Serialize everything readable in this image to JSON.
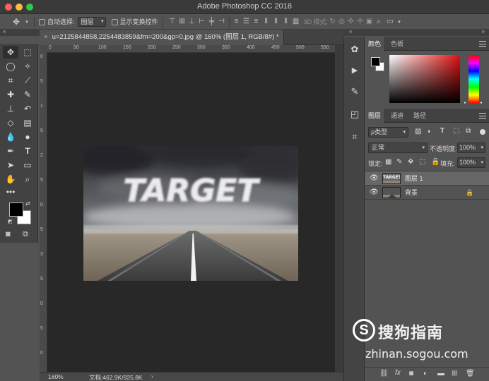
{
  "window": {
    "title": "Adobe Photoshop CC 2018"
  },
  "options_bar": {
    "auto_select_label": "自动选择:",
    "auto_select_value": "图层",
    "show_transform_label": "显示变换控件",
    "mode_3d_label": "3D 模式:"
  },
  "document": {
    "tab_title": "u=2125844858,2254483859&fm=200&gp=0.jpg @ 160% (图层 1, RGB/8#) *",
    "ruler_top_ticks": [
      "0",
      "50",
      "100",
      "150",
      "200",
      "250",
      "300",
      "350",
      "400",
      "450",
      "500",
      "550"
    ],
    "ruler_left_ticks": [
      "0",
      "5",
      "1",
      "5",
      "2",
      "5",
      "0",
      "5",
      "3",
      "5",
      "0",
      "5",
      "0"
    ],
    "artwork_text": "TARGET",
    "status": {
      "zoom": "160%",
      "doc_size": "文档:462.9K/925.8K"
    }
  },
  "colors": {
    "foreground": "#000000",
    "background": "#ffffff",
    "picker_hue": "#e01010"
  },
  "panels": {
    "color_tabs": [
      "颜色",
      "色板"
    ],
    "layer_tabs": [
      "图层",
      "通道",
      "路径"
    ],
    "filter_kind": "ρ类型",
    "blend_mode": "正常",
    "opacity_label": "不透明度:",
    "opacity_value": "100%",
    "lock_label": "锁定:",
    "fill_label": "填充:",
    "fill_value": "100%",
    "layers": [
      {
        "name": "图层 1",
        "selected": true,
        "locked": false
      },
      {
        "name": "背景",
        "selected": false,
        "locked": true
      }
    ]
  },
  "watermark": {
    "brand": "搜狗指南",
    "url": "zhinan.sogou.com"
  }
}
